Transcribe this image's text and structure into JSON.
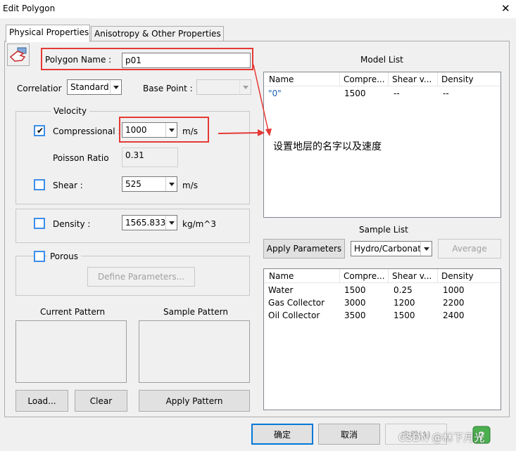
{
  "window": {
    "title": "Edit Polygon",
    "close_glyph": "✕"
  },
  "tabs": [
    {
      "label": "Physical Properties",
      "active": true
    },
    {
      "label": "Anisotropy & Other Properties",
      "active": false
    }
  ],
  "polygon": {
    "label": "Polygon Name :",
    "value": "p01"
  },
  "correlation": {
    "label": "Correlatior",
    "value": "Standard"
  },
  "base_point": {
    "label": "Base Point :",
    "value": ""
  },
  "velocity": {
    "group_label": "Velocity",
    "compressional": {
      "label": "Compressional :",
      "value": "1000",
      "unit": "m/s",
      "checked": true
    },
    "poisson": {
      "label": "Poisson Ratio",
      "value": "0.31"
    },
    "shear": {
      "label": "Shear :",
      "value": "525",
      "unit": "m/s",
      "checked": false
    }
  },
  "density": {
    "label": "Density :",
    "value": "1565.833",
    "unit": "kg/m^3",
    "checked": false
  },
  "porous": {
    "label": "Porous",
    "checked": false,
    "define_button": "Define Parameters..."
  },
  "pattern": {
    "current_label": "Current Pattern",
    "sample_label": "Sample Pattern",
    "load_button": "Load...",
    "clear_button": "Clear",
    "apply_button": "Apply Pattern"
  },
  "model_list": {
    "title": "Model List",
    "columns": [
      "Name",
      "Compre...",
      "Shear v...",
      "Density"
    ],
    "rows": [
      [
        "\"0\"",
        "1500",
        "--",
        "--"
      ]
    ]
  },
  "sample_list": {
    "title": "Sample List",
    "apply_button": "Apply Parameters",
    "type_value": "Hydro/Carbonat",
    "average_button": "Average",
    "columns": [
      "Name",
      "Compre...",
      "Shear v...",
      "Density"
    ],
    "rows": [
      [
        "Water",
        "1500",
        "0.25",
        "1000"
      ],
      [
        "Gas Collector",
        "3000",
        "1200",
        "2200"
      ],
      [
        "Oil Collector",
        "3500",
        "1500",
        "2400"
      ]
    ]
  },
  "footer": {
    "ok_button": "确定",
    "cancel_button": "取消",
    "apply_button": "应用(A)"
  },
  "annotation": {
    "text": "设置地层的名字以及速度",
    "color": "#e53935"
  },
  "watermark": "CSDN @林下月光",
  "colors": {
    "highlight_blue": "#3c8ee8",
    "model_row_text": "#1a5fb4",
    "default_button_border": "#0078d7"
  }
}
